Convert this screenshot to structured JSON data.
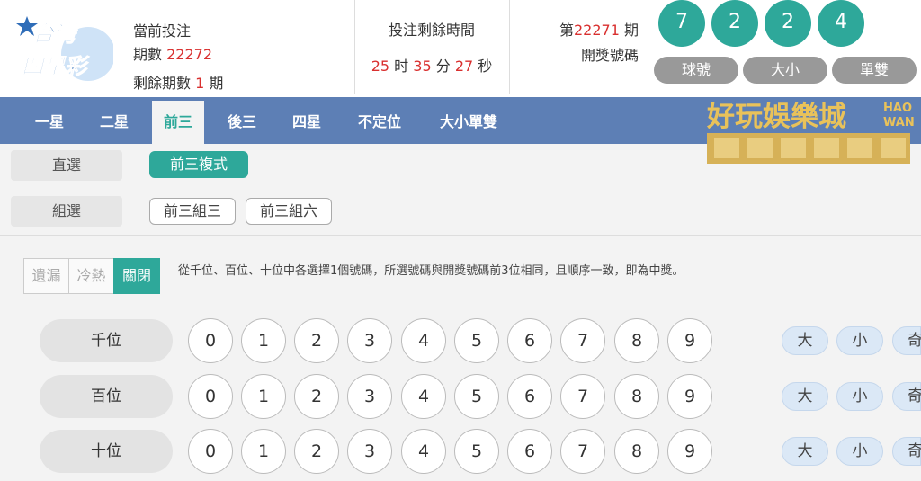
{
  "header": {
    "logo_line1": "台灣",
    "logo_line2": "四星彩",
    "current_bet_label": "當前投注",
    "issue_label": "期數",
    "issue_value": "22272",
    "remaining_issues_label": "剩餘期數",
    "remaining_issues_value": "1",
    "remaining_issues_unit": "期",
    "countdown_title": "投注剩餘時間",
    "countdown_hours": "25",
    "countdown_hours_unit": "时",
    "countdown_minutes": "35",
    "countdown_minutes_unit": "分",
    "countdown_seconds": "27",
    "countdown_seconds_unit": "秒",
    "draw_prefix": "第",
    "draw_issue": "22271",
    "draw_suffix": "期",
    "draw_numbers_label": "開獎號碼",
    "balls": [
      "7",
      "2",
      "2",
      "4"
    ],
    "ball_color": "#2ea89a",
    "view_buttons": [
      "球號",
      "大小",
      "單雙"
    ]
  },
  "nav": {
    "tabs": [
      "一星",
      "二星",
      "前三",
      "後三",
      "四星",
      "不定位",
      "大小單雙"
    ],
    "active_index": 2,
    "bar_color": "#5d7fb5"
  },
  "banner": {
    "title": "好玩娛樂城",
    "sub1": "HAO",
    "sub2": "WAN"
  },
  "modes": {
    "direct_label": "直選",
    "direct_options": [
      "前三複式"
    ],
    "group_label": "組選",
    "group_options": [
      "前三組三",
      "前三組六"
    ]
  },
  "stats": {
    "toggles": [
      "遺漏",
      "冷熱",
      "關閉"
    ],
    "active_index": 2
  },
  "description": "從千位、百位、十位中各選擇1個號碼，所選號碼與開獎號碼前3位相同，且順序一致，即為中獎。",
  "rows": [
    {
      "label": "千位"
    },
    {
      "label": "百位"
    },
    {
      "label": "十位"
    }
  ],
  "digits": [
    "0",
    "1",
    "2",
    "3",
    "4",
    "5",
    "6",
    "7",
    "8",
    "9"
  ],
  "quick": [
    "大",
    "小",
    "奇"
  ],
  "accent_color": "#2ea89a"
}
